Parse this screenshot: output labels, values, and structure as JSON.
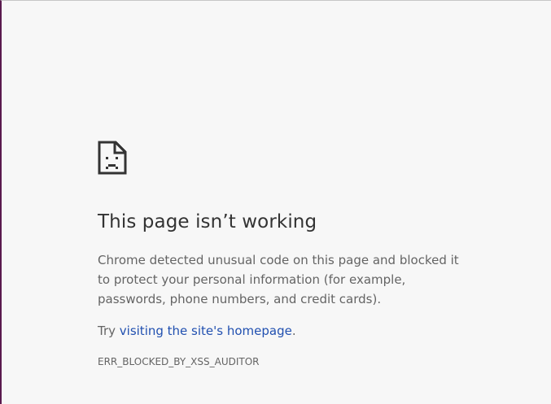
{
  "page": {
    "icon": "sad-page-icon",
    "title": "This page isn’t working",
    "description": "Chrome detected unusual code on this page and blocked it to protect your personal information (for example, passwords, phone numbers, and credit cards).",
    "suggestion_prefix": "Try ",
    "suggestion_link": "visiting the site's homepage",
    "suggestion_suffix": ".",
    "error_code": "ERR_BLOCKED_BY_XSS_AUDITOR"
  },
  "colors": {
    "background": "#f7f7f7",
    "title": "#333333",
    "body_text": "#646464",
    "link": "#2150b0",
    "left_border": "#5a1a4e"
  }
}
